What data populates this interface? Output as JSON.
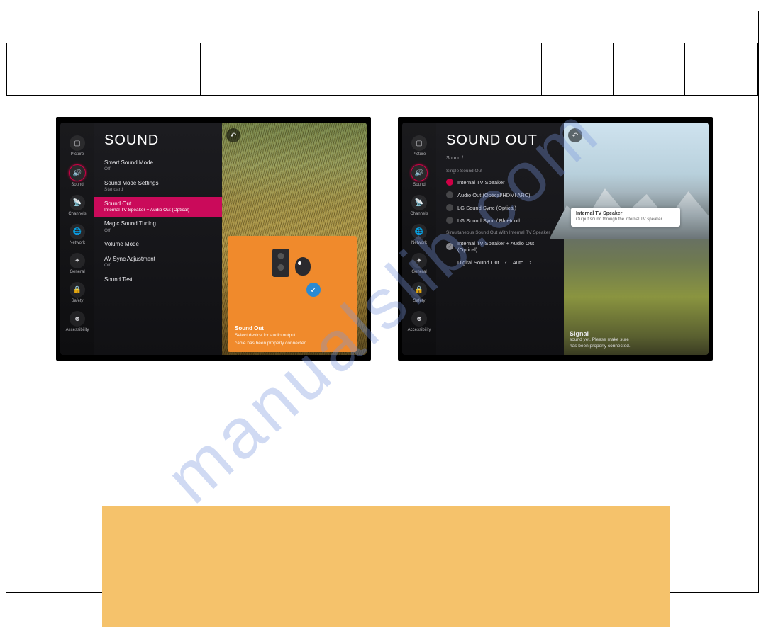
{
  "watermark": "manualslib.com",
  "sidebar": {
    "items": [
      {
        "label": "Picture"
      },
      {
        "label": "Sound"
      },
      {
        "label": "Channels"
      },
      {
        "label": "Network"
      },
      {
        "label": "General"
      },
      {
        "label": "Safety"
      },
      {
        "label": "Accessibility"
      }
    ]
  },
  "screen1": {
    "title": "SOUND",
    "items": [
      {
        "lbl": "Smart Sound Mode",
        "val": "Off"
      },
      {
        "lbl": "Sound Mode Settings",
        "val": "Standard"
      },
      {
        "lbl": "Sound Out",
        "val": "Internal TV Speaker + Audio Out (Optical)"
      },
      {
        "lbl": "Magic Sound Tuning",
        "val": "Off"
      },
      {
        "lbl": "Volume Mode",
        "val": ""
      },
      {
        "lbl": "AV Sync Adjustment",
        "val": "Off"
      },
      {
        "lbl": "Sound Test",
        "val": ""
      }
    ],
    "card": {
      "title": "Sound Out",
      "line1": "Select device for audio output.",
      "line2": "cable has been properly connected."
    }
  },
  "screen2": {
    "title": "SOUND OUT",
    "breadcrumb": "Sound /",
    "section1": "Single Sound Out",
    "options": [
      "Internal TV Speaker",
      "Audio Out (Optical/HDMI ARC)",
      "LG Sound Sync (Optical)",
      "LG Sound Sync / Bluetooth"
    ],
    "section2": "Simultaneous Sound Out With Internal TV Speaker",
    "option_combo": "Internal TV Speaker + Audio Out (Optical)",
    "picker": {
      "label": "Digital Sound Out",
      "value": "Auto"
    },
    "tooltip": {
      "title": "Internal TV Speaker",
      "text": "Output sound through the internal TV speaker."
    },
    "overlay": {
      "title": "Signal",
      "line1": "sound yet. Please make sure",
      "line2": "has been properly connected."
    }
  }
}
